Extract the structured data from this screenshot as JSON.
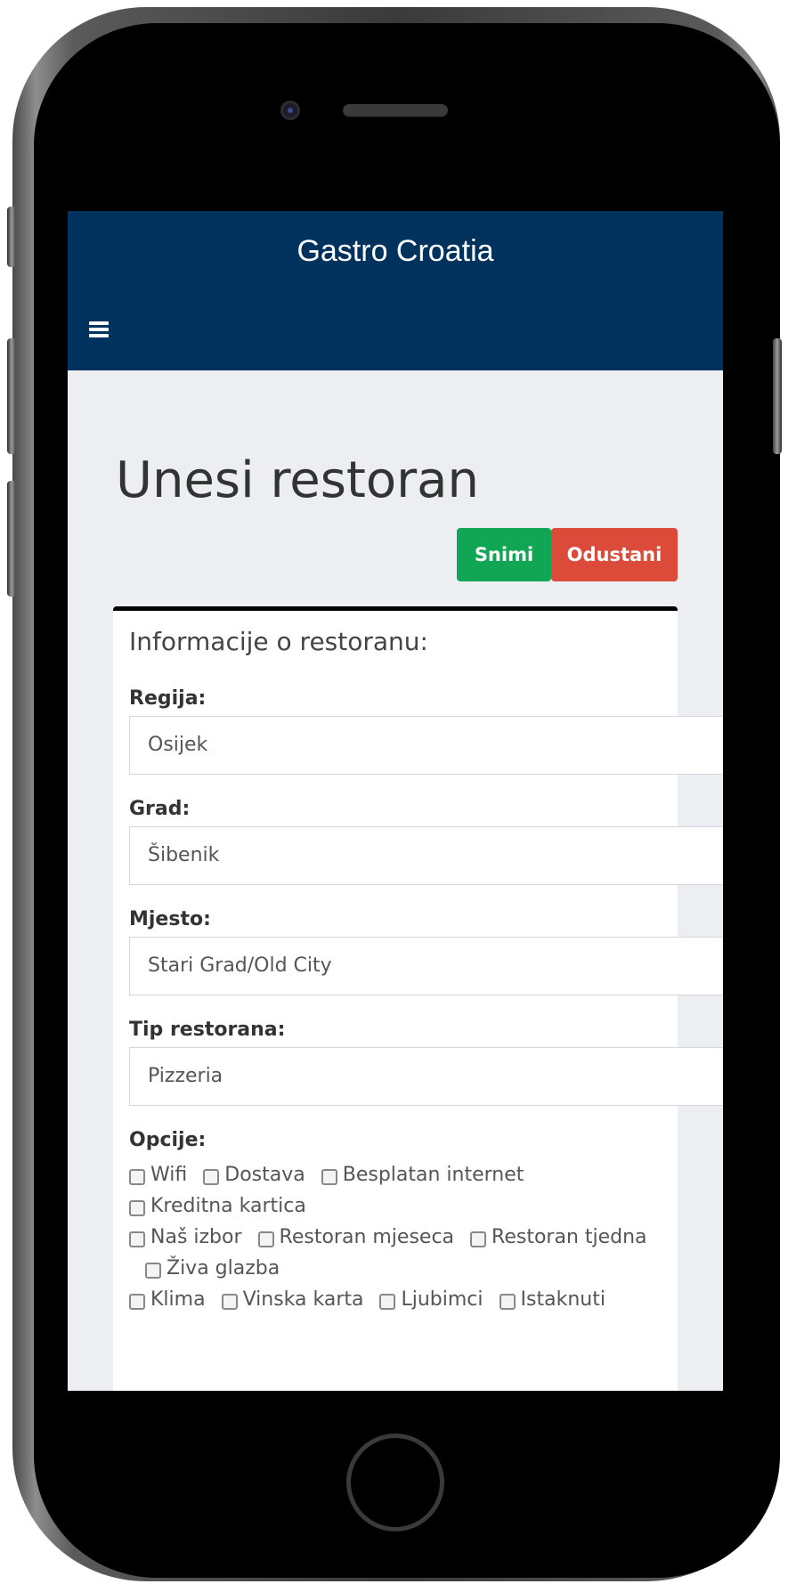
{
  "app": {
    "brand": "Gastro Croatia"
  },
  "page": {
    "title": "Unesi restoran",
    "save_label": "Snimi",
    "cancel_label": "Odustani"
  },
  "panel": {
    "title": "Informacije o restoranu:",
    "fields": [
      {
        "label": "Regija:",
        "value": "Osijek"
      },
      {
        "label": "Grad:",
        "value": "Šibenik"
      },
      {
        "label": "Mjesto:",
        "value": "Stari Grad/Old City"
      },
      {
        "label": "Tip restorana:",
        "value": "Pizzeria"
      }
    ],
    "options_label": "Opcije:",
    "options": [
      {
        "label": "Wifi",
        "checked": false
      },
      {
        "label": "Dostava",
        "checked": false
      },
      {
        "label": "Besplatan internet",
        "checked": false
      },
      {
        "label": "Kreditna kartica",
        "checked": false
      },
      {
        "label": "Naš izbor",
        "checked": false
      },
      {
        "label": "Restoran mjeseca",
        "checked": false
      },
      {
        "label": "Restoran tjedna",
        "checked": false
      },
      {
        "label": "Živa glazba",
        "checked": false
      },
      {
        "label": "Klima",
        "checked": false
      },
      {
        "label": "Vinska karta",
        "checked": false
      },
      {
        "label": "Ljubimci",
        "checked": false
      },
      {
        "label": "Istaknuti",
        "checked": false
      }
    ]
  },
  "icons": {
    "menu": "hamburger-menu-icon"
  },
  "colors": {
    "navbar": "#00325e",
    "save": "#11a653",
    "cancel": "#dc4b39",
    "background": "#eceef2"
  }
}
